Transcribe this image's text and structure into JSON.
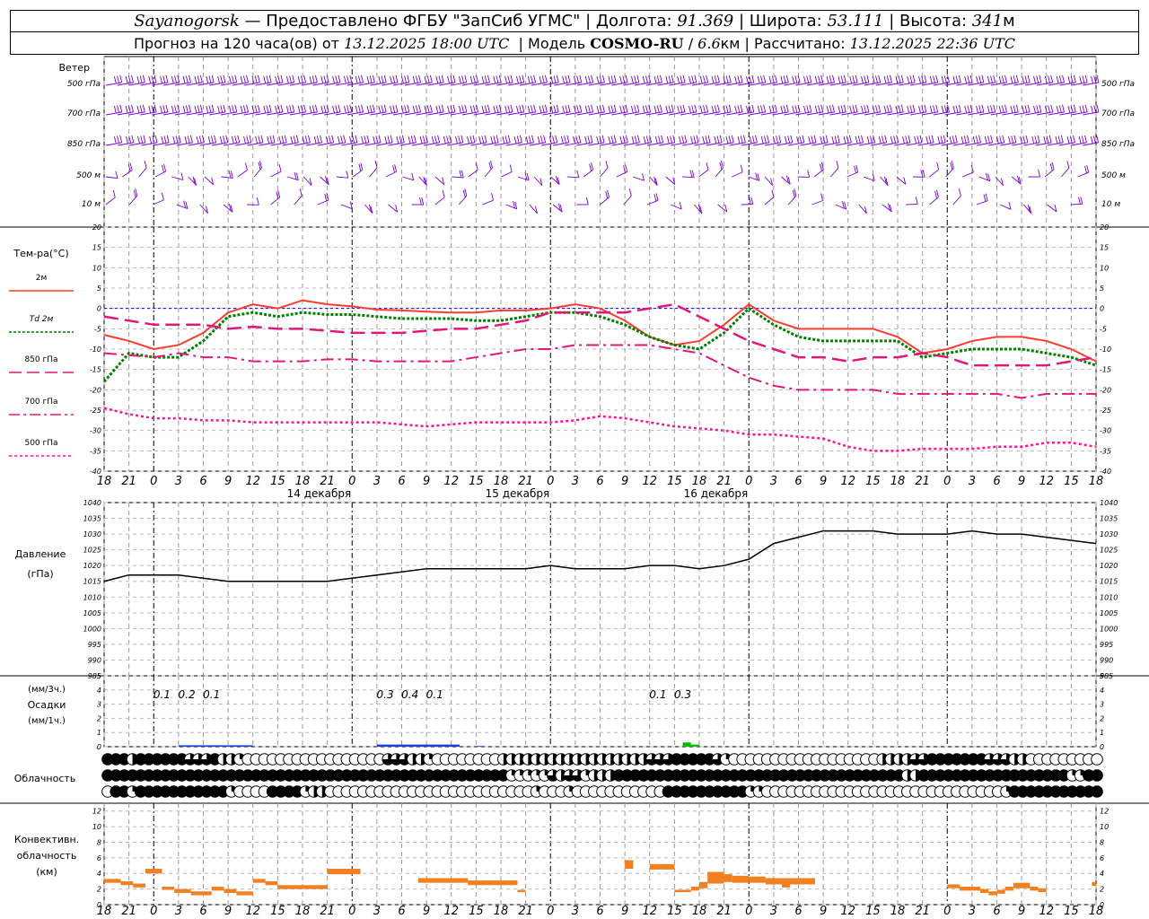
{
  "header": {
    "station": "Sayanogorsk",
    "provider_text": "— Предоставлено ФГБУ \"ЗапСиб УГМС\"",
    "lon_label": "Долгота:",
    "lon_value": "91.369",
    "lat_label": "Широта:",
    "lat_value": "53.111",
    "alt_label": "Высота:",
    "alt_value": "341",
    "alt_unit": "м",
    "forecast_label": "Прогноз на 120 часа(ов) от",
    "forecast_start": "13.12.2025 18:00 UTC",
    "model_label": "Модель",
    "model_name": "COSMO-RU",
    "model_res": "6.6",
    "model_res_unit": "км",
    "calc_label": "Рассчитано:",
    "calc_time": "13.12.2025 22:36 UTC"
  },
  "panels": {
    "wind": {
      "title": "Ветер",
      "levels": [
        "500 гПа",
        "700 гПа",
        "850 гПа",
        "500 м",
        "10 м"
      ]
    },
    "temp": {
      "title": "Тем-ра(°C)",
      "legend": [
        "2м",
        "Td 2м",
        "850 гПа",
        "700 гПа",
        "500 гПа"
      ]
    },
    "pressure": {
      "title": "Давление",
      "unit": "(гПа)"
    },
    "precip": {
      "title": "Осадки",
      "unit_3h": "(мм/3ч.)",
      "unit_1h": "(мм/1ч.)"
    },
    "cloud": {
      "title": "Облачность"
    },
    "convective": {
      "title": [
        "Конвективн.",
        "облачность",
        "(км)"
      ]
    }
  },
  "time_axis": {
    "tick_labels": [
      "18",
      "21",
      "0",
      "3",
      "6",
      "9",
      "12",
      "15",
      "18",
      "21",
      "0",
      "3",
      "6",
      "9",
      "12",
      "15",
      "18",
      "21",
      "0",
      "3",
      "6",
      "9",
      "12",
      "15",
      "18",
      "21",
      "0",
      "3",
      "6",
      "9",
      "12",
      "15",
      "18",
      "21",
      "0",
      "3",
      "6",
      "9",
      "12",
      "15",
      "18",
      "21",
      "0"
    ],
    "day_labels": [
      "14 декабря",
      "15 декабря",
      "16 декабря"
    ]
  },
  "colors": {
    "t2m": "#ff3b30",
    "td2m": "#008000",
    "t850": "#e0187a",
    "t700": "#e0187a",
    "t500": "#ff1493",
    "wind": "#7a00d0",
    "pressure": "#000000",
    "precip_blue": "#1f3fd6",
    "precip_green": "#00c000",
    "convective": "#f08020",
    "zero_line": "#0000ff"
  },
  "chart_data": [
    {
      "type": "line",
      "name": "temperature",
      "ylim": [
        -40,
        20
      ],
      "yticks": [
        -40,
        -35,
        -30,
        -25,
        -20,
        -15,
        -10,
        -5,
        0,
        5,
        10,
        15,
        20
      ],
      "x_hours": [
        0,
        3,
        6,
        9,
        12,
        15,
        18,
        21,
        24,
        27,
        30,
        33,
        36,
        39,
        42,
        45,
        48,
        51,
        54,
        57,
        60,
        63,
        66,
        69,
        72,
        75,
        78,
        81,
        84,
        87,
        90,
        93,
        96,
        99,
        102,
        105,
        108,
        111,
        114,
        117,
        120
      ],
      "series": [
        {
          "name": "2м",
          "values": [
            -6.5,
            -8,
            -10,
            -9,
            -6,
            -1,
            1,
            0,
            2,
            1,
            0.5,
            -0.3,
            -0.5,
            -0.8,
            -1,
            -1,
            -0.5,
            -0.5,
            0,
            1,
            0,
            -3,
            -7,
            -9,
            -8,
            -4,
            1,
            -3,
            -5,
            -5,
            -5,
            -5,
            -7,
            -11,
            -10,
            -8,
            -7,
            -7,
            -8,
            -10,
            -13
          ]
        },
        {
          "name": "Td 2м",
          "values": [
            -18,
            -11,
            -12,
            -12,
            -8,
            -2,
            -1,
            -2,
            -1,
            -1.5,
            -1.5,
            -2,
            -2.5,
            -2.5,
            -2.5,
            -3,
            -3,
            -2,
            -1,
            -1,
            -2,
            -4,
            -7,
            -9,
            -10,
            -6,
            0,
            -4,
            -7,
            -8,
            -8,
            -8,
            -8,
            -12,
            -11,
            -10,
            -10,
            -10,
            -11,
            -12,
            -14
          ]
        },
        {
          "name": "850 гПа",
          "values": [
            -2,
            -3,
            -4,
            -4,
            -4,
            -5,
            -4.5,
            -5,
            -5,
            -5.5,
            -6,
            -6,
            -6,
            -5.5,
            -5,
            -5,
            -4,
            -3,
            -1,
            -1,
            -1,
            -1,
            0,
            1,
            -2,
            -5,
            -8,
            -10,
            -12,
            -12,
            -13,
            -12,
            -12,
            -11,
            -12,
            -14,
            -14,
            -14,
            -14,
            -13,
            -12
          ]
        },
        {
          "name": "700 гПа",
          "values": [
            -11,
            -11.5,
            -12,
            -11,
            -12,
            -12,
            -13,
            -13,
            -13,
            -12.5,
            -12.5,
            -13,
            -13,
            -13,
            -13,
            -12,
            -11,
            -10,
            -10,
            -9,
            -9,
            -9,
            -9,
            -10,
            -11,
            -14,
            -17,
            -19,
            -20,
            -20,
            -20,
            -20,
            -21,
            -21,
            -21,
            -21,
            -21,
            -22,
            -21,
            -21,
            -21
          ]
        },
        {
          "name": "500 гПа",
          "values": [
            -24.5,
            -26,
            -27,
            -27,
            -27.5,
            -27.5,
            -28,
            -28,
            -28,
            -28,
            -28,
            -28,
            -28.5,
            -29,
            -28.5,
            -28,
            -28,
            -28,
            -28,
            -27.5,
            -26.5,
            -27,
            -28,
            -29,
            -29.5,
            -30,
            -31,
            -31,
            -31.5,
            -32,
            -34,
            -35,
            -35,
            -34.5,
            -34.5,
            -34.5,
            -34,
            -34,
            -33,
            -33,
            -34
          ]
        }
      ]
    },
    {
      "type": "line",
      "name": "pressure",
      "ylim": [
        985,
        1040
      ],
      "yticks": [
        985,
        990,
        995,
        1000,
        1005,
        1010,
        1015,
        1020,
        1025,
        1030,
        1035,
        1040
      ],
      "x_hours": [
        0,
        3,
        6,
        9,
        12,
        15,
        18,
        21,
        24,
        27,
        30,
        33,
        36,
        39,
        42,
        45,
        48,
        51,
        54,
        57,
        60,
        63,
        66,
        69,
        72,
        75,
        78,
        81,
        84,
        87,
        90,
        93,
        96,
        99,
        102,
        105,
        108,
        111,
        114,
        117,
        120
      ],
      "series": [
        {
          "name": "Давление",
          "values": [
            1015,
            1017,
            1017,
            1017,
            1016,
            1015,
            1015,
            1015,
            1015,
            1015,
            1016,
            1017,
            1018,
            1019,
            1019,
            1019,
            1019,
            1019,
            1020,
            1019,
            1019,
            1019,
            1020,
            1020,
            1019,
            1020,
            1022,
            1027,
            1029,
            1031,
            1031,
            1031,
            1030,
            1030,
            1030,
            1031,
            1030,
            1030,
            1029,
            1028,
            1027
          ]
        }
      ]
    },
    {
      "type": "bar",
      "name": "precipitation",
      "ylim": [
        0,
        5
      ],
      "yticks": [
        0,
        1,
        2,
        3,
        4,
        5
      ],
      "labels_3h": [
        {
          "hour": 7,
          "text": "0.1"
        },
        {
          "hour": 10,
          "text": "0.2"
        },
        {
          "hour": 13,
          "text": "0.1"
        },
        {
          "hour": 34,
          "text": "0.3"
        },
        {
          "hour": 37,
          "text": "0.4"
        },
        {
          "hour": 40,
          "text": "0.1"
        },
        {
          "hour": 67,
          "text": "0.1"
        },
        {
          "hour": 70,
          "text": "0.3"
        }
      ],
      "bars_1h": [
        {
          "start": 9,
          "end": 18,
          "value": 0.1,
          "kind": "snow"
        },
        {
          "start": 33,
          "end": 43,
          "value": 0.15,
          "kind": "snow"
        },
        {
          "start": 45,
          "end": 46,
          "value": 0.05,
          "kind": "snow"
        },
        {
          "start": 70,
          "end": 71,
          "value": 0.3,
          "kind": "rain"
        },
        {
          "start": 71,
          "end": 72,
          "value": 0.15,
          "kind": "rain"
        }
      ]
    },
    {
      "type": "bar",
      "name": "convective_cloud",
      "ylim": [
        0,
        13
      ],
      "yticks": [
        0,
        2,
        4,
        6,
        8,
        10,
        12
      ],
      "bars": [
        {
          "start": 0,
          "end": 2,
          "bottom": 2.8,
          "top": 3.3
        },
        {
          "start": 2,
          "end": 3.5,
          "bottom": 2.5,
          "top": 3.0
        },
        {
          "start": 3.5,
          "end": 5,
          "bottom": 2.2,
          "top": 2.7
        },
        {
          "start": 5,
          "end": 7,
          "bottom": 4.0,
          "top": 4.6
        },
        {
          "start": 7,
          "end": 8.5,
          "bottom": 1.9,
          "top": 2.3
        },
        {
          "start": 8.5,
          "end": 10.5,
          "bottom": 1.5,
          "top": 2.0
        },
        {
          "start": 10.5,
          "end": 13,
          "bottom": 1.2,
          "top": 1.7
        },
        {
          "start": 13,
          "end": 14.5,
          "bottom": 1.8,
          "top": 2.3
        },
        {
          "start": 14.5,
          "end": 16,
          "bottom": 1.5,
          "top": 2.0
        },
        {
          "start": 16,
          "end": 18,
          "bottom": 1.2,
          "top": 1.7
        },
        {
          "start": 18,
          "end": 19.5,
          "bottom": 2.8,
          "top": 3.3
        },
        {
          "start": 19.5,
          "end": 21,
          "bottom": 2.5,
          "top": 3.0
        },
        {
          "start": 21,
          "end": 27,
          "bottom": 2.0,
          "top": 2.5
        },
        {
          "start": 27,
          "end": 31,
          "bottom": 3.9,
          "top": 4.6
        },
        {
          "start": 38,
          "end": 44,
          "bottom": 2.8,
          "top": 3.4
        },
        {
          "start": 44,
          "end": 50,
          "bottom": 2.5,
          "top": 3.1
        },
        {
          "start": 50,
          "end": 51,
          "bottom": 1.6,
          "top": 1.9
        },
        {
          "start": 63,
          "end": 64,
          "bottom": 4.6,
          "top": 5.7
        },
        {
          "start": 66,
          "end": 69,
          "bottom": 4.5,
          "top": 5.2
        },
        {
          "start": 69,
          "end": 71,
          "bottom": 1.6,
          "top": 1.9
        },
        {
          "start": 71,
          "end": 72,
          "bottom": 1.8,
          "top": 2.3
        },
        {
          "start": 72,
          "end": 73,
          "bottom": 2.1,
          "top": 2.9
        },
        {
          "start": 73,
          "end": 75,
          "bottom": 2.7,
          "top": 4.2
        },
        {
          "start": 75,
          "end": 76,
          "bottom": 2.9,
          "top": 3.9
        },
        {
          "start": 76,
          "end": 78,
          "bottom": 2.8,
          "top": 3.7
        },
        {
          "start": 78,
          "end": 80,
          "bottom": 2.8,
          "top": 3.6
        },
        {
          "start": 80,
          "end": 84,
          "bottom": 2.6,
          "top": 3.4
        },
        {
          "start": 82,
          "end": 83,
          "bottom": 2.2,
          "top": 2.8
        },
        {
          "start": 84,
          "end": 86,
          "bottom": 2.6,
          "top": 3.4
        },
        {
          "start": 102,
          "end": 103.5,
          "bottom": 2.1,
          "top": 2.6
        },
        {
          "start": 103.5,
          "end": 106,
          "bottom": 1.8,
          "top": 2.3
        },
        {
          "start": 106,
          "end": 107,
          "bottom": 1.5,
          "top": 2.0
        },
        {
          "start": 107,
          "end": 108,
          "bottom": 1.2,
          "top": 1.7
        },
        {
          "start": 108,
          "end": 109,
          "bottom": 1.4,
          "top": 1.9
        },
        {
          "start": 109,
          "end": 110,
          "bottom": 1.8,
          "top": 2.3
        },
        {
          "start": 110,
          "end": 112,
          "bottom": 2.1,
          "top": 2.8
        },
        {
          "start": 112,
          "end": 113,
          "bottom": 1.8,
          "top": 2.3
        },
        {
          "start": 113,
          "end": 114,
          "bottom": 1.6,
          "top": 2.1
        },
        {
          "start": 119.5,
          "end": 120,
          "bottom": 2.4,
          "top": 2.9
        }
      ]
    }
  ],
  "cloudiness": {
    "rows": 3,
    "levels_per_row": [
      [
        8,
        8,
        8,
        4,
        8,
        8,
        8,
        8,
        8,
        8,
        6,
        6,
        6,
        8,
        4,
        4,
        2,
        0,
        0,
        0,
        0,
        0,
        0,
        0,
        0,
        0,
        0,
        0,
        0,
        0,
        0,
        0,
        0,
        0,
        6,
        6,
        6,
        4,
        4,
        2,
        0,
        0,
        0,
        0,
        0,
        0,
        0,
        0,
        4,
        4,
        4,
        4,
        4,
        4,
        4,
        4,
        4,
        4,
        4,
        4,
        4,
        4,
        4,
        4,
        4,
        4,
        6,
        6,
        6,
        8,
        8,
        8,
        8,
        8,
        6,
        2,
        0,
        0,
        0,
        0,
        0,
        0,
        0,
        0,
        0,
        0,
        0,
        0,
        0,
        0,
        0,
        0,
        0,
        0,
        4,
        4,
        4,
        4,
        6,
        6,
        8,
        8,
        8,
        8,
        8,
        8,
        8,
        6,
        6,
        6,
        4,
        4,
        0,
        0,
        0,
        0,
        0,
        0,
        0,
        0,
        0
      ],
      [
        8,
        8,
        8,
        8,
        8,
        8,
        8,
        8,
        8,
        8,
        8,
        8,
        8,
        8,
        8,
        8,
        8,
        8,
        8,
        8,
        8,
        8,
        8,
        8,
        8,
        8,
        8,
        8,
        8,
        8,
        8,
        8,
        8,
        8,
        8,
        8,
        8,
        8,
        8,
        8,
        8,
        8,
        8,
        8,
        8,
        8,
        8,
        8,
        8,
        2,
        2,
        2,
        2,
        2,
        6,
        4,
        6,
        6,
        2,
        4,
        4,
        4,
        8,
        8,
        8,
        8,
        8,
        8,
        8,
        8,
        8,
        8,
        8,
        8,
        8,
        8,
        8,
        8,
        8,
        8,
        8,
        8,
        8,
        8,
        8,
        8,
        8,
        8,
        8,
        8,
        8,
        8,
        8,
        8,
        8,
        8,
        8,
        4,
        4,
        8,
        8,
        8,
        8,
        8,
        8,
        8,
        8,
        8,
        8,
        8,
        8,
        8,
        8,
        8,
        8,
        8,
        8,
        2,
        2,
        8,
        8
      ],
      [
        0,
        8,
        8,
        2,
        8,
        8,
        8,
        8,
        8,
        8,
        8,
        8,
        8,
        8,
        8,
        2,
        0,
        0,
        0,
        0,
        8,
        8,
        8,
        8,
        2,
        4,
        4,
        0,
        0,
        0,
        0,
        0,
        0,
        0,
        0,
        0,
        0,
        0,
        0,
        0,
        0,
        0,
        0,
        0,
        0,
        0,
        0,
        0,
        0,
        0,
        0,
        0,
        2,
        0,
        0,
        0,
        2,
        0,
        0,
        0,
        0,
        0,
        0,
        0,
        0,
        0,
        0,
        0,
        8,
        8,
        8,
        8,
        8,
        8,
        8,
        8,
        8,
        8,
        2,
        2,
        0,
        0,
        0,
        0,
        0,
        0,
        0,
        0,
        0,
        0,
        0,
        0,
        0,
        0,
        0,
        0,
        0,
        0,
        0,
        0,
        0,
        0,
        0,
        0,
        0,
        0,
        0,
        0,
        0,
        2,
        8,
        8,
        8,
        8,
        8,
        8,
        8,
        8,
        8,
        8,
        8
      ]
    ]
  }
}
